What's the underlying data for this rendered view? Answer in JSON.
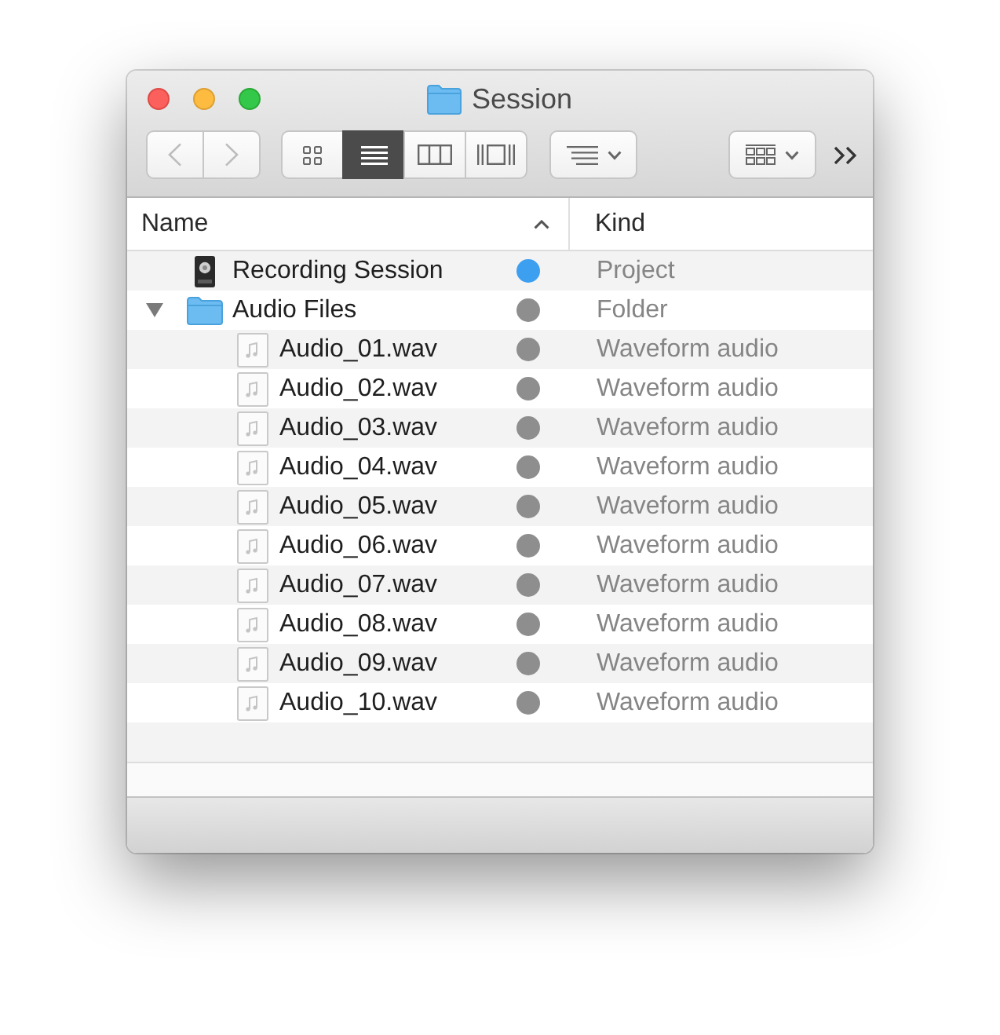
{
  "window": {
    "title": "Session"
  },
  "toolbar": {
    "navigation": [
      {
        "kind": "back",
        "disabled": true
      },
      {
        "kind": "forward",
        "disabled": true
      }
    ],
    "view_modes": [
      {
        "kind": "icon",
        "selected": false
      },
      {
        "kind": "list",
        "selected": true
      },
      {
        "kind": "column",
        "selected": false
      },
      {
        "kind": "gallery",
        "selected": false
      }
    ],
    "menus": [
      {
        "kind": "arrange"
      },
      {
        "kind": "group"
      }
    ],
    "overflow": true
  },
  "columns": [
    {
      "label": "Name",
      "sorted": true
    },
    {
      "label": "Kind",
      "sorted": false
    }
  ],
  "items": [
    {
      "name": "Recording Session",
      "kind": "project",
      "color": "#3d9ff0",
      "kind_label": "Project"
    },
    {
      "name": "Audio Files",
      "kind": "folder",
      "expanded": true,
      "color": "#8e8e8e",
      "kind_label": "Folder",
      "children": [
        {
          "name": "Audio_01.wav",
          "kind": "audio",
          "color": "#8e8e8e",
          "kind_label": "Waveform audio"
        },
        {
          "name": "Audio_02.wav",
          "kind": "audio",
          "color": "#8e8e8e",
          "kind_label": "Waveform audio"
        },
        {
          "name": "Audio_03.wav",
          "kind": "audio",
          "color": "#8e8e8e",
          "kind_label": "Waveform audio"
        },
        {
          "name": "Audio_04.wav",
          "kind": "audio",
          "color": "#8e8e8e",
          "kind_label": "Waveform audio"
        },
        {
          "name": "Audio_05.wav",
          "kind": "audio",
          "color": "#8e8e8e",
          "kind_label": "Waveform audio"
        },
        {
          "name": "Audio_06.wav",
          "kind": "audio",
          "color": "#8e8e8e",
          "kind_label": "Waveform audio"
        },
        {
          "name": "Audio_07.wav",
          "kind": "audio",
          "color": "#8e8e8e",
          "kind_label": "Waveform audio"
        },
        {
          "name": "Audio_08.wav",
          "kind": "audio",
          "color": "#8e8e8e",
          "kind_label": "Waveform audio"
        },
        {
          "name": "Audio_09.wav",
          "kind": "audio",
          "color": "#8e8e8e",
          "kind_label": "Waveform audio"
        },
        {
          "name": "Audio_10.wav",
          "kind": "audio",
          "color": "#8e8e8e",
          "kind_label": "Waveform audio"
        }
      ]
    }
  ]
}
